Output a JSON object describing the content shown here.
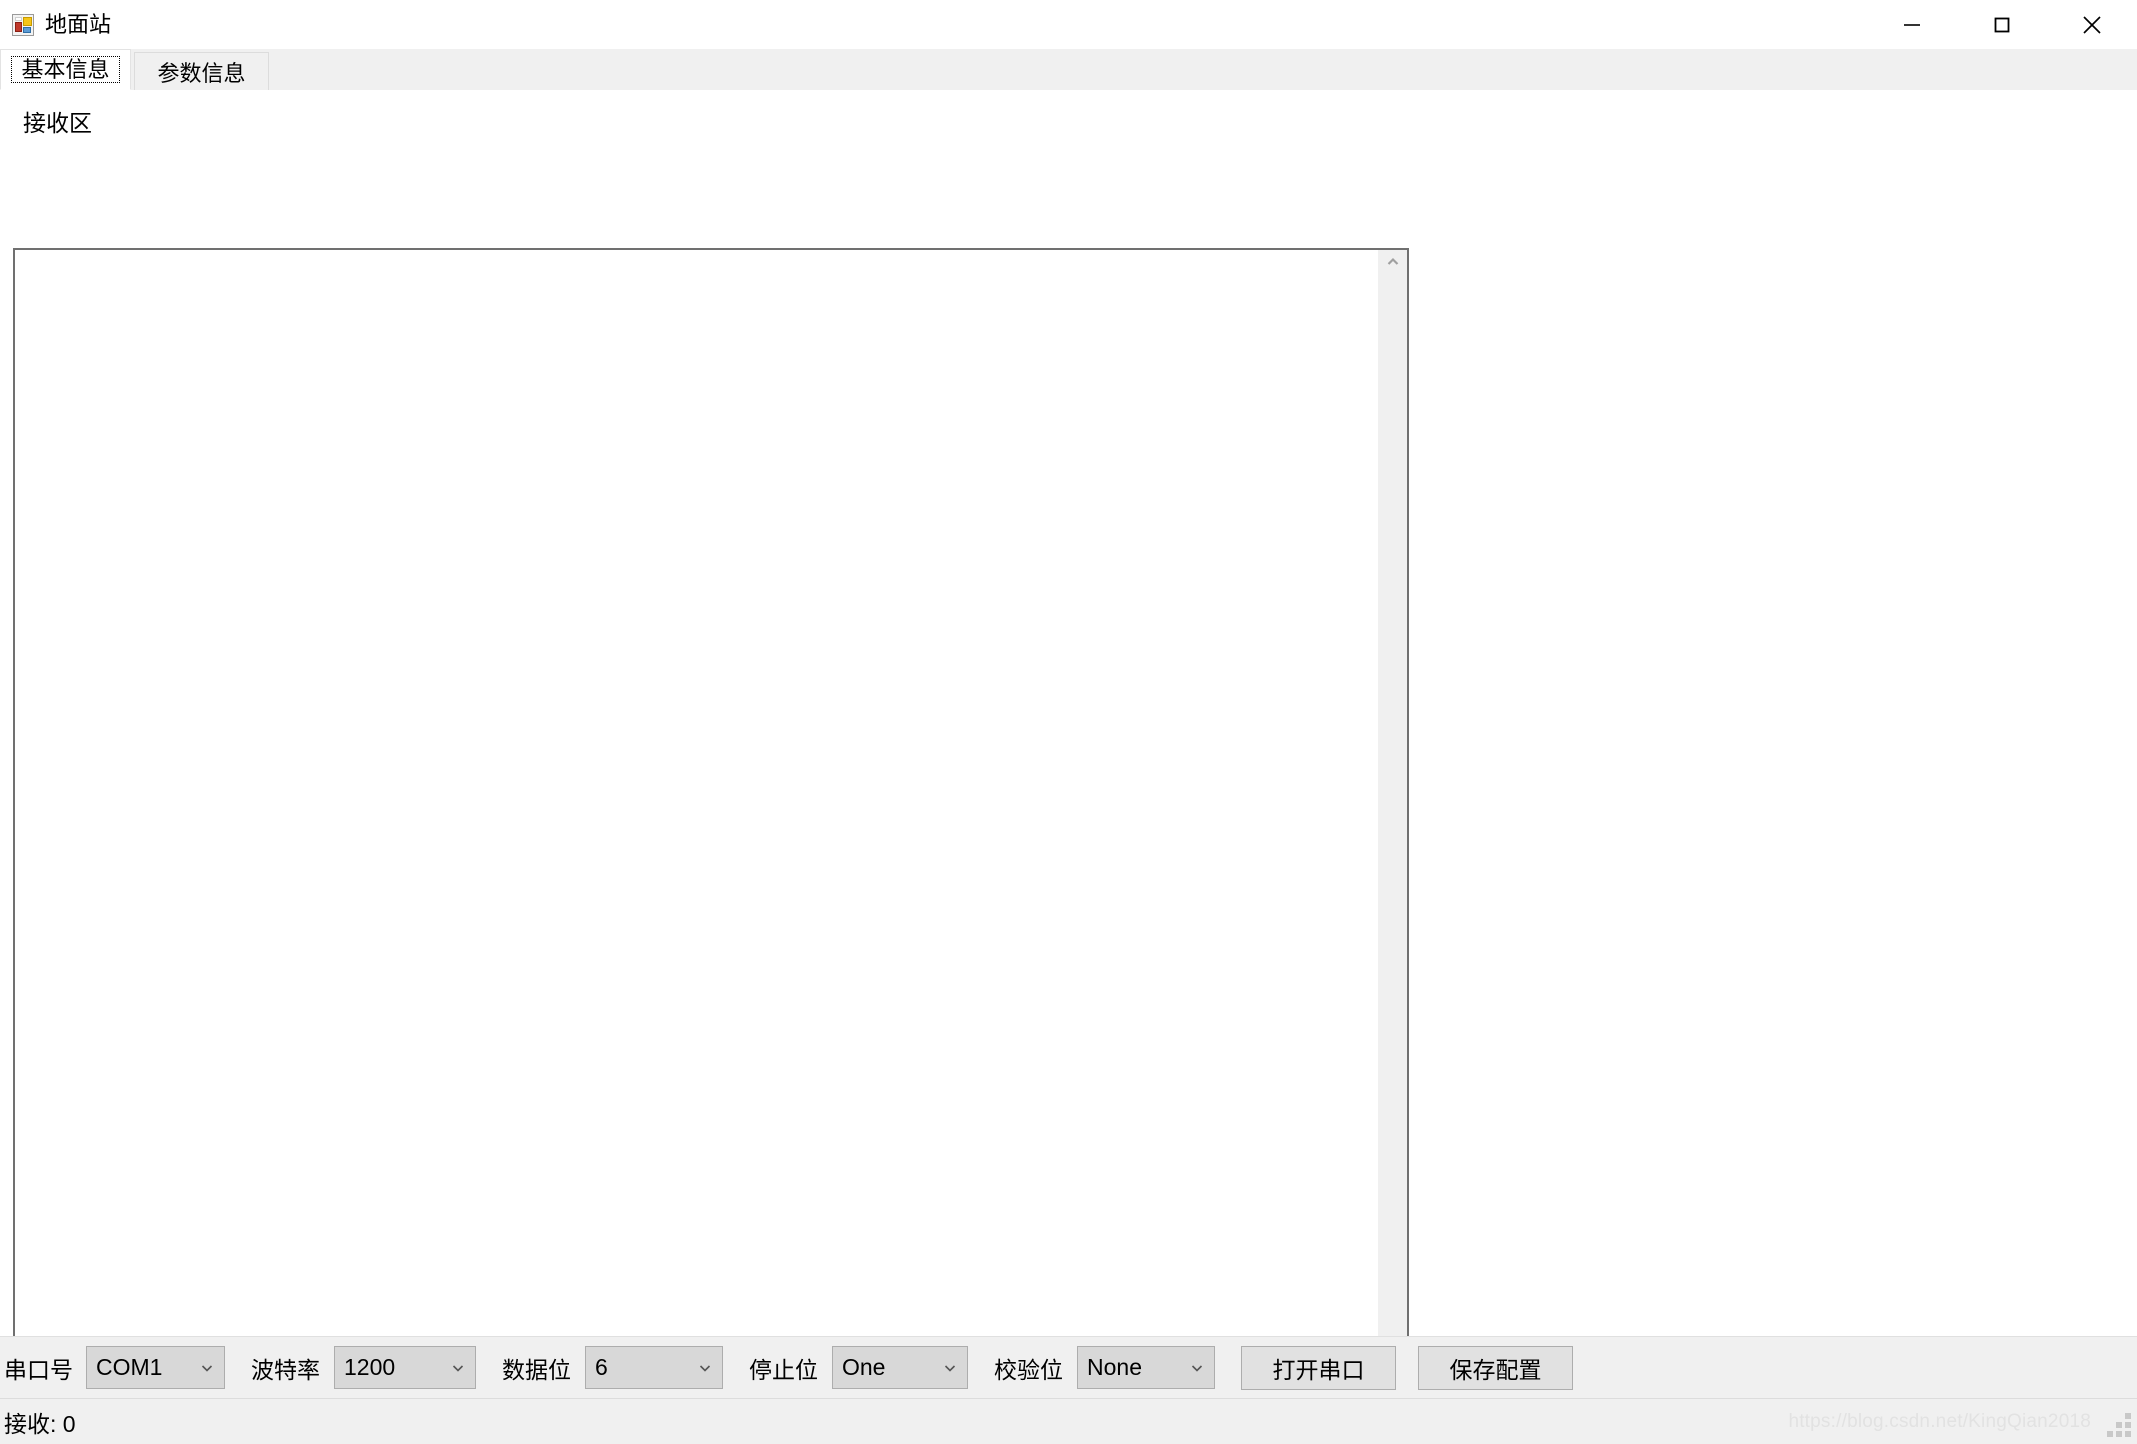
{
  "window": {
    "title": "地面站",
    "icon": "winforms-app-icon",
    "controls": [
      {
        "name": "minimize-button",
        "glyph": "minimize-icon"
      },
      {
        "name": "maximize-button",
        "glyph": "maximize-icon"
      },
      {
        "name": "close-button",
        "glyph": "close-icon"
      }
    ]
  },
  "tabs": [
    {
      "label": "基本信息",
      "active": true
    },
    {
      "label": "参数信息",
      "active": false
    }
  ],
  "receive_area": {
    "group_label": "接收区",
    "text": "",
    "scrollbar": {
      "up_icon": "chevron-up-icon",
      "down_icon": "chevron-down-icon"
    }
  },
  "config": {
    "port": {
      "label": "串口号",
      "value": "COM1",
      "arrow_icon": "chevron-down-icon"
    },
    "baud": {
      "label": "波特率",
      "value": "1200",
      "arrow_icon": "chevron-down-icon"
    },
    "databits": {
      "label": "数据位",
      "value": "6",
      "arrow_icon": "chevron-down-icon"
    },
    "stopbits": {
      "label": "停止位",
      "value": "One",
      "arrow_icon": "chevron-down-icon"
    },
    "parity": {
      "label": "校验位",
      "value": "None",
      "arrow_icon": "chevron-down-icon"
    },
    "open_button": "打开串口",
    "save_button": "保存配置"
  },
  "status": {
    "received_label": "接收: 0",
    "watermark": "https://blog.csdn.net/KingQian2018"
  },
  "colors": {
    "panel": "#f0f0f0",
    "page": "#ffffff",
    "combo_face": "#d8d8d8",
    "button_face": "#e1e1e1",
    "border": "#adadad",
    "textbox_border": "#707070",
    "watermark": "#e2e2e2"
  }
}
